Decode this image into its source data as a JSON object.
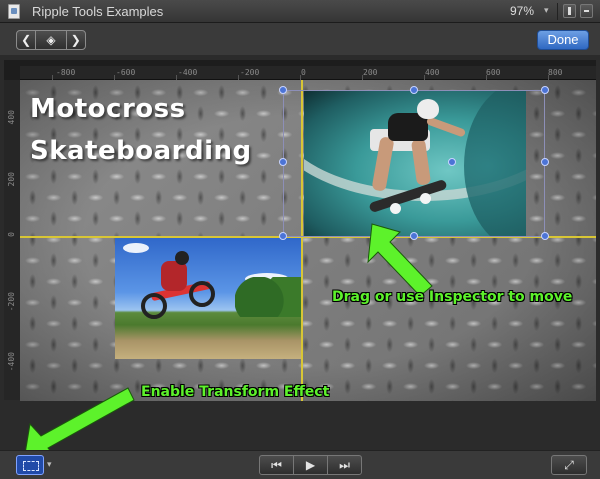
{
  "window": {
    "title": "Ripple Tools Examples",
    "zoom": "97%",
    "zoom_caret": "▾"
  },
  "toolbar": {
    "back_glyph": "❮",
    "transform_glyph": "◈",
    "forward_glyph": "❯",
    "done_label": "Done"
  },
  "rulers": {
    "top": [
      "-800",
      "-600",
      "-400",
      "-200",
      "0",
      "200",
      "400",
      "600",
      "800"
    ],
    "left": [
      "400",
      "200",
      "0",
      "-200",
      "-400"
    ]
  },
  "canvas": {
    "title_line1": "Motocross",
    "title_line2": "Skateboarding"
  },
  "annotations": {
    "move_hint": "Drag or use Inspector to move",
    "transform_hint": "Enable Transform Effect",
    "arrow_color": "#5df22b"
  },
  "bottom": {
    "transform_caret": "▾",
    "prev_glyph": "⏮",
    "play_glyph": "▶",
    "next_glyph": "⏭",
    "fullscreen_glyph": "⤢"
  },
  "colors": {
    "accent": "#2f68c2",
    "guide": "#d8c635",
    "handle": "#4c74d6"
  }
}
